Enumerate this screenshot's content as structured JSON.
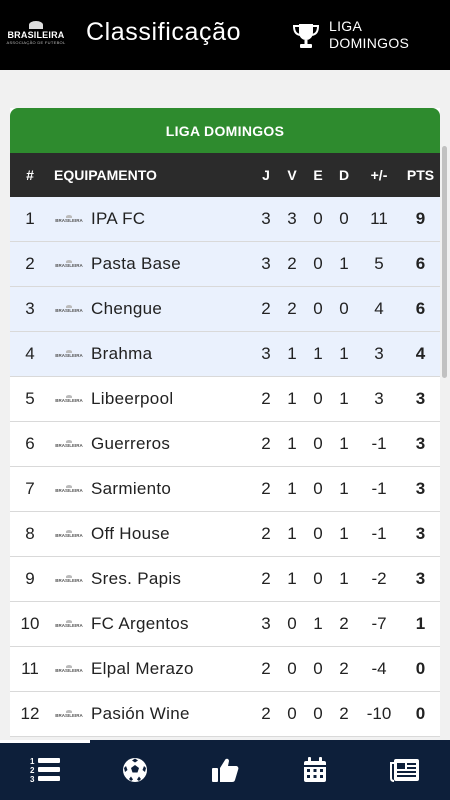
{
  "header": {
    "logo_word": "BRASILEIRA",
    "logo_tag": "ASSOCIAÇÃO DE FUTEBOL",
    "title": "Classificação",
    "league_line1": "LIGA",
    "league_line2": "DOMINGOS"
  },
  "table": {
    "title": "LIGA DOMINGOS",
    "headers": {
      "pos": "#",
      "team": "EQUIPAMENTO",
      "j": "J",
      "v": "V",
      "e": "E",
      "d": "D",
      "diff": "+/-",
      "pts": "PTS"
    },
    "rows": [
      {
        "pos": "1",
        "team": "IPA FC",
        "j": "3",
        "v": "3",
        "e": "0",
        "d": "0",
        "diff": "11",
        "pts": "9"
      },
      {
        "pos": "2",
        "team": "Pasta Base",
        "j": "3",
        "v": "2",
        "e": "0",
        "d": "1",
        "diff": "5",
        "pts": "6"
      },
      {
        "pos": "3",
        "team": "Chengue",
        "j": "2",
        "v": "2",
        "e": "0",
        "d": "0",
        "diff": "4",
        "pts": "6"
      },
      {
        "pos": "4",
        "team": "Brahma",
        "j": "3",
        "v": "1",
        "e": "1",
        "d": "1",
        "diff": "3",
        "pts": "4"
      },
      {
        "pos": "5",
        "team": "Libeerpool",
        "j": "2",
        "v": "1",
        "e": "0",
        "d": "1",
        "diff": "3",
        "pts": "3"
      },
      {
        "pos": "6",
        "team": "Guerreros",
        "j": "2",
        "v": "1",
        "e": "0",
        "d": "1",
        "diff": "-1",
        "pts": "3"
      },
      {
        "pos": "7",
        "team": "Sarmiento",
        "j": "2",
        "v": "1",
        "e": "0",
        "d": "1",
        "diff": "-1",
        "pts": "3"
      },
      {
        "pos": "8",
        "team": "Off House",
        "j": "2",
        "v": "1",
        "e": "0",
        "d": "1",
        "diff": "-1",
        "pts": "3"
      },
      {
        "pos": "9",
        "team": "Sres. Papis",
        "j": "2",
        "v": "1",
        "e": "0",
        "d": "1",
        "diff": "-2",
        "pts": "3"
      },
      {
        "pos": "10",
        "team": "FC Argentos",
        "j": "3",
        "v": "0",
        "e": "1",
        "d": "2",
        "diff": "-7",
        "pts": "1"
      },
      {
        "pos": "11",
        "team": "Elpal Merazo",
        "j": "2",
        "v": "0",
        "e": "0",
        "d": "2",
        "diff": "-4",
        "pts": "0"
      },
      {
        "pos": "12",
        "team": "Pasión Wine",
        "j": "2",
        "v": "0",
        "e": "0",
        "d": "2",
        "diff": "-10",
        "pts": "0"
      }
    ],
    "highlighted_rows": 4
  },
  "nav": {
    "items": [
      "standings-icon",
      "soccer-ball-icon",
      "thumbs-up-icon",
      "calendar-icon",
      "news-icon"
    ],
    "active": 0
  },
  "colors": {
    "header_bg": "#000000",
    "card_title_bg": "#2e8b2e",
    "table_head_bg": "#2b2b2b",
    "highlight_row": "#eaf1fd",
    "navbar_bg": "#0d1f3a"
  }
}
